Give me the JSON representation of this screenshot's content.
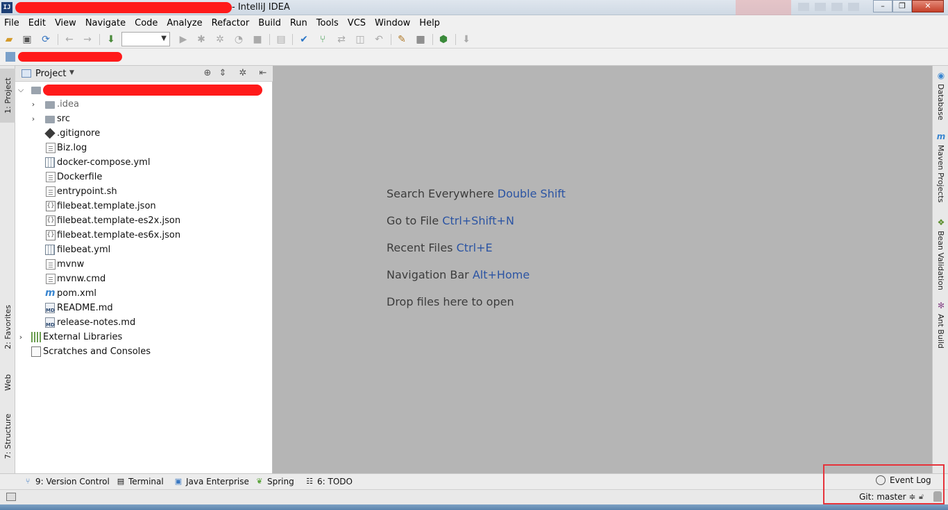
{
  "window": {
    "title_suffix": "- IntelliJ IDEA",
    "app_icon_text": "IJ"
  },
  "menu": [
    "File",
    "Edit",
    "View",
    "Navigate",
    "Code",
    "Analyze",
    "Refactor",
    "Build",
    "Run",
    "Tools",
    "VCS",
    "Window",
    "Help"
  ],
  "project_panel": {
    "title": "Project",
    "tree": [
      {
        "label": ".idea",
        "type": "folder",
        "expanded": false
      },
      {
        "label": "src",
        "type": "folder",
        "expanded": false
      },
      {
        "label": ".gitignore",
        "type": "git"
      },
      {
        "label": "Biz.log",
        "type": "file"
      },
      {
        "label": "docker-compose.yml",
        "type": "grid"
      },
      {
        "label": "Dockerfile",
        "type": "file"
      },
      {
        "label": "entrypoint.sh",
        "type": "file"
      },
      {
        "label": "filebeat.template.json",
        "type": "json"
      },
      {
        "label": "filebeat.template-es2x.json",
        "type": "json"
      },
      {
        "label": "filebeat.template-es6x.json",
        "type": "json"
      },
      {
        "label": "filebeat.yml",
        "type": "grid"
      },
      {
        "label": "mvnw",
        "type": "file"
      },
      {
        "label": "mvnw.cmd",
        "type": "file"
      },
      {
        "label": "pom.xml",
        "type": "maven"
      },
      {
        "label": "README.md",
        "type": "md"
      },
      {
        "label": "release-notes.md",
        "type": "md"
      },
      {
        "label": "External Libraries",
        "type": "lib"
      },
      {
        "label": "Scratches and Consoles",
        "type": "scratch"
      }
    ]
  },
  "left_tabs": {
    "project": "1: Project",
    "favorites": "2: Favorites",
    "web": "Web",
    "structure": "7: Structure"
  },
  "right_tabs": {
    "database": "Database",
    "maven": "Maven Projects",
    "bean": "Bean Validation",
    "ant": "Ant Build"
  },
  "editor_hints": [
    {
      "text": "Search Everywhere",
      "key": "Double Shift"
    },
    {
      "text": "Go to File",
      "key": "Ctrl+Shift+N"
    },
    {
      "text": "Recent Files",
      "key": "Ctrl+E"
    },
    {
      "text": "Navigation Bar",
      "key": "Alt+Home"
    },
    {
      "text": "Drop files here to open",
      "key": ""
    }
  ],
  "bottom_tabs": {
    "version_control": "9: Version Control",
    "terminal": "Terminal",
    "java_enterprise": "Java Enterprise",
    "spring": "Spring",
    "todo": "6: TODO",
    "event_log": "Event Log"
  },
  "status": {
    "git_branch": "Git: master ≑"
  },
  "colors": {
    "editor_bg": "#b5b5b5",
    "key_hint": "#2b54a3",
    "highlight": "#e6333b"
  }
}
